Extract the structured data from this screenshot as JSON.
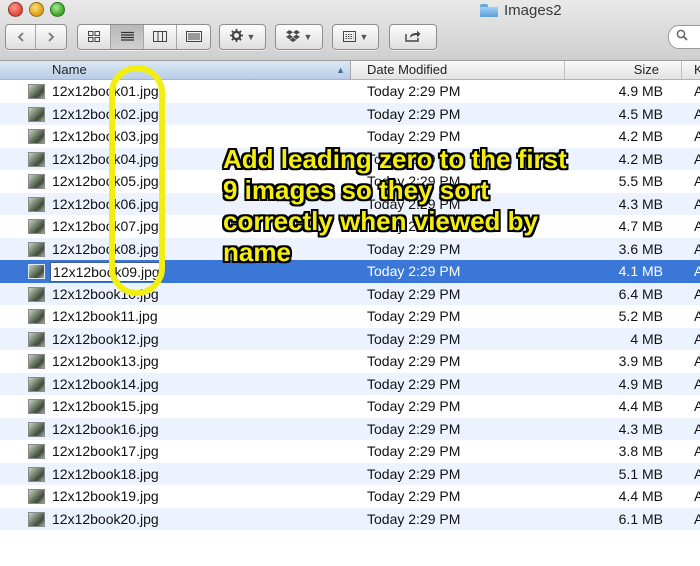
{
  "window": {
    "title": "Images2"
  },
  "toolbar": {
    "nav_back_icon": "chevron-left-icon",
    "nav_forward_icon": "chevron-right-icon",
    "view_modes": [
      "icon-view-icon",
      "list-view-icon",
      "column-view-icon",
      "coverflow-view-icon"
    ],
    "active_view": "list-view-icon",
    "action_icon": "gear-icon",
    "dropbox_icon": "dropbox-icon",
    "arrange_icon": "arrange-icon",
    "share_icon": "share-icon"
  },
  "columns": {
    "name": "Name",
    "date": "Date Modified",
    "size": "Size",
    "kind": "K"
  },
  "files": [
    {
      "name": "12x12book01.jpg",
      "date": "Today 2:29 PM",
      "size": "4.9 MB",
      "kind": "A"
    },
    {
      "name": "12x12book02.jpg",
      "date": "Today 2:29 PM",
      "size": "4.5 MB",
      "kind": "A"
    },
    {
      "name": "12x12book03.jpg",
      "date": "Today 2:29 PM",
      "size": "4.2 MB",
      "kind": "A"
    },
    {
      "name": "12x12book04.jpg",
      "date": "Today 2:29 PM",
      "size": "4.2 MB",
      "kind": "A"
    },
    {
      "name": "12x12book05.jpg",
      "date": "Today 2:29 PM",
      "size": "5.5 MB",
      "kind": "A"
    },
    {
      "name": "12x12book06.jpg",
      "date": "Today 2:29 PM",
      "size": "4.3 MB",
      "kind": "A"
    },
    {
      "name": "12x12book07.jpg",
      "date": "Today 2:29 PM",
      "size": "4.7 MB",
      "kind": "A"
    },
    {
      "name": "12x12book08.jpg",
      "date": "Today 2:29 PM",
      "size": "3.6 MB",
      "kind": "A"
    },
    {
      "name": "12x12book09.jpg",
      "date": "Today 2:29 PM",
      "size": "4.1 MB",
      "kind": "A",
      "selected": true
    },
    {
      "name": "12x12book10.jpg",
      "date": "Today 2:29 PM",
      "size": "6.4 MB",
      "kind": "A"
    },
    {
      "name": "12x12book11.jpg",
      "date": "Today 2:29 PM",
      "size": "5.2 MB",
      "kind": "A"
    },
    {
      "name": "12x12book12.jpg",
      "date": "Today 2:29 PM",
      "size": "4 MB",
      "kind": "A"
    },
    {
      "name": "12x12book13.jpg",
      "date": "Today 2:29 PM",
      "size": "3.9 MB",
      "kind": "A"
    },
    {
      "name": "12x12book14.jpg",
      "date": "Today 2:29 PM",
      "size": "4.9 MB",
      "kind": "A"
    },
    {
      "name": "12x12book15.jpg",
      "date": "Today 2:29 PM",
      "size": "4.4 MB",
      "kind": "A"
    },
    {
      "name": "12x12book16.jpg",
      "date": "Today 2:29 PM",
      "size": "4.3 MB",
      "kind": "A"
    },
    {
      "name": "12x12book17.jpg",
      "date": "Today 2:29 PM",
      "size": "3.8 MB",
      "kind": "A"
    },
    {
      "name": "12x12book18.jpg",
      "date": "Today 2:29 PM",
      "size": "5.1 MB",
      "kind": "A"
    },
    {
      "name": "12x12book19.jpg",
      "date": "Today 2:29 PM",
      "size": "4.4 MB",
      "kind": "A"
    },
    {
      "name": "12x12book20.jpg",
      "date": "Today 2:29 PM",
      "size": "6.1 MB",
      "kind": "A"
    }
  ],
  "annotation": {
    "text": "Add leading zero to the first 9 images so they sort correctly when viewed by name",
    "color": "#f4ee10"
  },
  "colors": {
    "selection": "#3a77d7",
    "alt_row": "#edf3fe",
    "highlight": "#f3ee12"
  }
}
